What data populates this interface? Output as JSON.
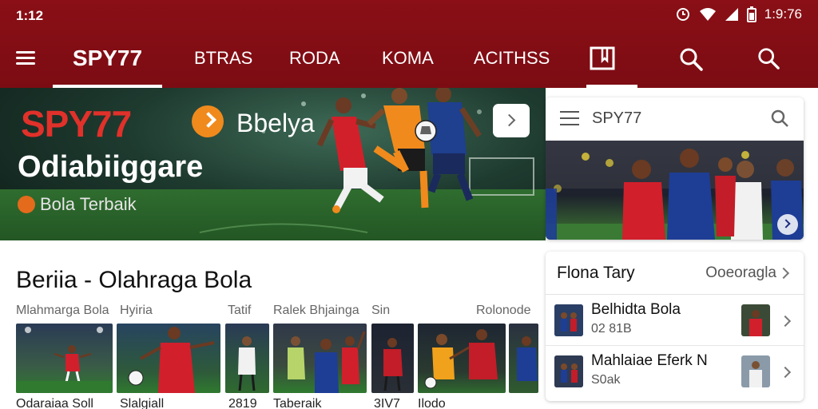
{
  "status_bar": {
    "time": "1:12",
    "clock": "1:9:76"
  },
  "nav": {
    "brand": "SPY77",
    "tabs": [
      "BTRAS",
      "RODA",
      "KOMA",
      "ACITHSS"
    ]
  },
  "hero": {
    "brand": "SPY77",
    "subtitle": "Bbelya",
    "title": "Odiabiiggare",
    "tagline": "Bola Terbaik"
  },
  "mini_card": {
    "title": "SPY77"
  },
  "section": {
    "title": "Beriia - Olahraga Bola",
    "columns": [
      "Mlahmarga Bola",
      "Hyiria",
      "Tatif",
      "Ralek Bhjainga",
      "Sin",
      "Rolonode"
    ],
    "captions": [
      "Odaraiaa Soll",
      "Slalgiall",
      "2819",
      "Taberaik",
      "3IV7",
      "Ilodo"
    ]
  },
  "list_panel": {
    "title": "Flona Tary",
    "link": "Ooeoragla",
    "rows": [
      {
        "name": "Belhidta Bola",
        "sub": "02 81B"
      },
      {
        "name": "Mahlaiae Eferk N",
        "sub": "S0ak"
      }
    ]
  },
  "colors": {
    "header": "#7c0c13",
    "brand_red": "#e0312a",
    "accent_orange": "#f08a1c"
  },
  "icons": [
    "hamburger-icon",
    "book-icon",
    "search-icon",
    "chevron-right-icon",
    "wifi-icon",
    "battery-icon"
  ]
}
